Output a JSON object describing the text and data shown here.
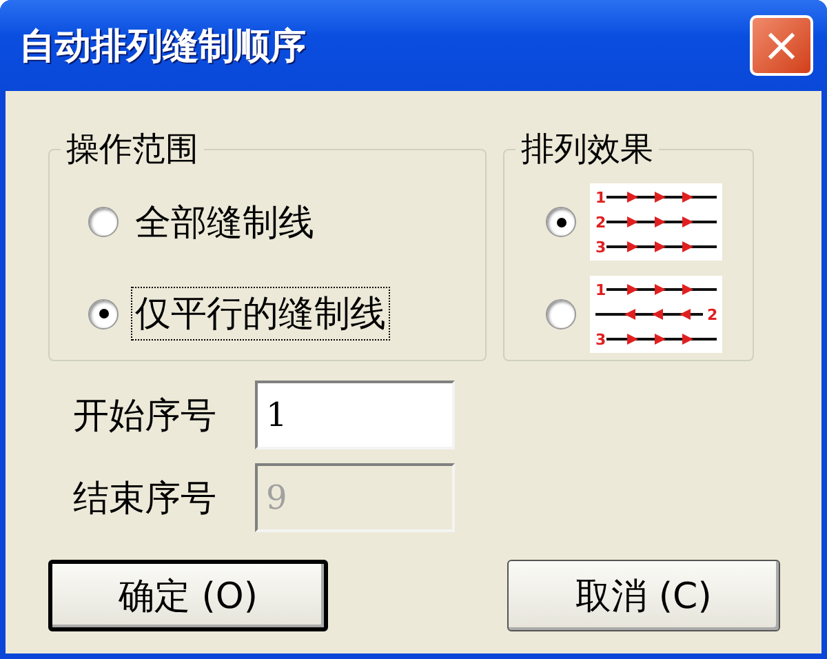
{
  "window": {
    "title": "自动排列缝制顺序",
    "close": "×"
  },
  "scope": {
    "title": "操作范围",
    "options": [
      {
        "label": "全部缝制线",
        "selected": false,
        "focused": false
      },
      {
        "label": "仅平行的缝制线",
        "selected": true,
        "focused": true
      }
    ]
  },
  "effect": {
    "title": "排列效果",
    "options": [
      {
        "kind": "same-direction",
        "selected": true,
        "row_labels": [
          "1",
          "2",
          "3"
        ]
      },
      {
        "kind": "alternating",
        "selected": false,
        "row_labels": [
          "1",
          "2",
          "3"
        ]
      }
    ]
  },
  "fields": [
    {
      "label": "开始序号",
      "value": "1",
      "disabled": false
    },
    {
      "label": "结束序号",
      "value": "9",
      "disabled": true
    }
  ],
  "buttons": [
    {
      "label": "确定 (O)",
      "default": true
    },
    {
      "label": "取消 (C)",
      "default": false
    }
  ]
}
